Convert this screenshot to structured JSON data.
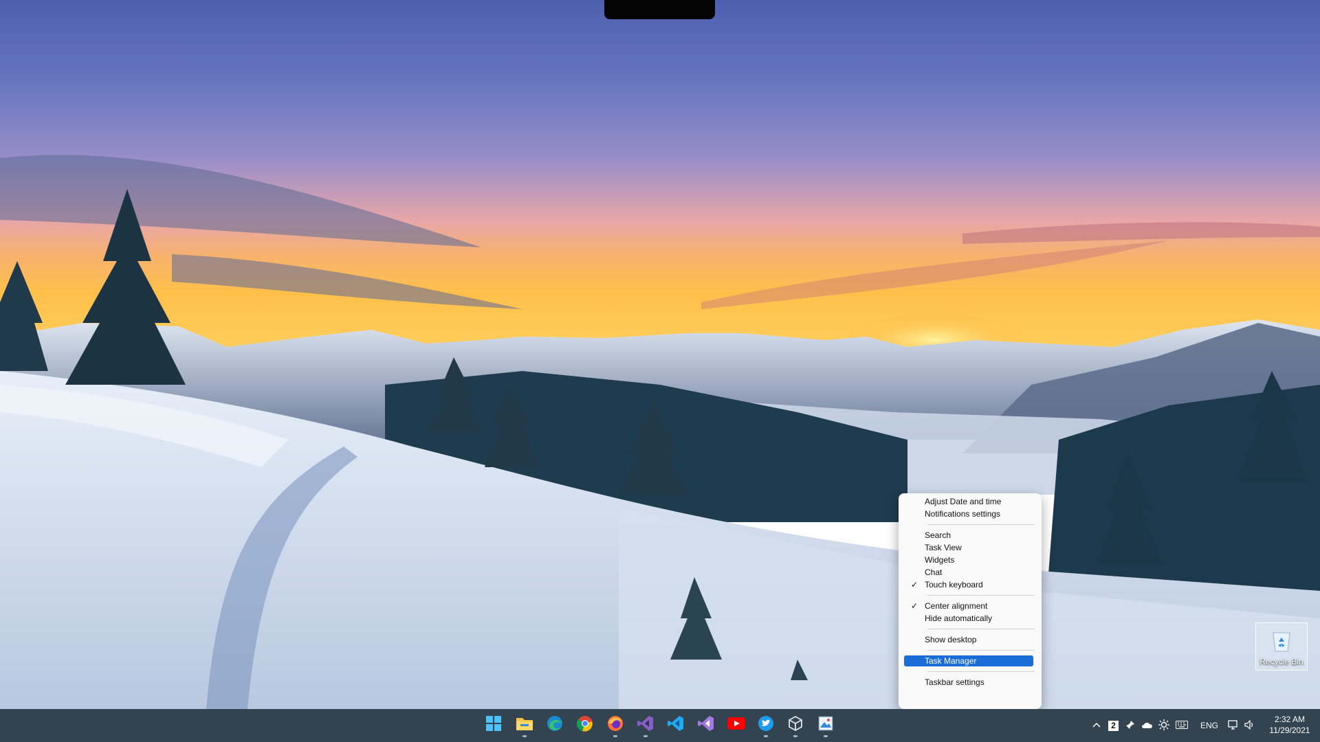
{
  "desktop": {
    "icons": [
      {
        "label": "Recycle Bin",
        "icon": "recycle-bin-icon"
      }
    ]
  },
  "context_menu": {
    "items": [
      {
        "label": "Adjust Date and time",
        "checked": false,
        "highlighted": false
      },
      {
        "label": "Notifications settings",
        "checked": false,
        "highlighted": false
      },
      {
        "label": "Search",
        "checked": false,
        "highlighted": false
      },
      {
        "label": "Task View",
        "checked": false,
        "highlighted": false
      },
      {
        "label": "Widgets",
        "checked": false,
        "highlighted": false
      },
      {
        "label": "Chat",
        "checked": false,
        "highlighted": false
      },
      {
        "label": "Touch keyboard",
        "checked": true,
        "highlighted": false
      },
      {
        "label": "Center alignment",
        "checked": true,
        "highlighted": false
      },
      {
        "label": "Hide automatically",
        "checked": false,
        "highlighted": false
      },
      {
        "label": "Show desktop",
        "checked": false,
        "highlighted": false
      },
      {
        "label": "Task Manager",
        "checked": false,
        "highlighted": true
      },
      {
        "label": "Taskbar settings",
        "checked": false,
        "highlighted": false
      }
    ],
    "check_glyph": "✓",
    "highlight_color": "#1a6dd6"
  },
  "taskbar": {
    "apps": [
      {
        "name": "start-button",
        "icon": "windows-logo-icon",
        "running": false
      },
      {
        "name": "file-explorer",
        "icon": "folder-icon",
        "running": true
      },
      {
        "name": "edge",
        "icon": "edge-icon",
        "running": false
      },
      {
        "name": "chrome",
        "icon": "chrome-icon",
        "running": false
      },
      {
        "name": "firefox",
        "icon": "firefox-icon",
        "running": true
      },
      {
        "name": "visual-studio",
        "icon": "visual-studio-icon",
        "running": true
      },
      {
        "name": "vs-code",
        "icon": "vscode-icon",
        "running": false
      },
      {
        "name": "visual-studio-preview",
        "icon": "visual-studio-preview-icon",
        "running": false
      },
      {
        "name": "youtube",
        "icon": "youtube-icon",
        "running": false
      },
      {
        "name": "twitter",
        "icon": "twitter-icon",
        "running": true
      },
      {
        "name": "virtualbox",
        "icon": "cube-icon",
        "running": true
      },
      {
        "name": "paint",
        "icon": "paint-icon",
        "running": true
      }
    ],
    "tray": {
      "badge": "2",
      "language": "ENG",
      "time": "2:32 AM",
      "date": "11/29/2021"
    }
  }
}
